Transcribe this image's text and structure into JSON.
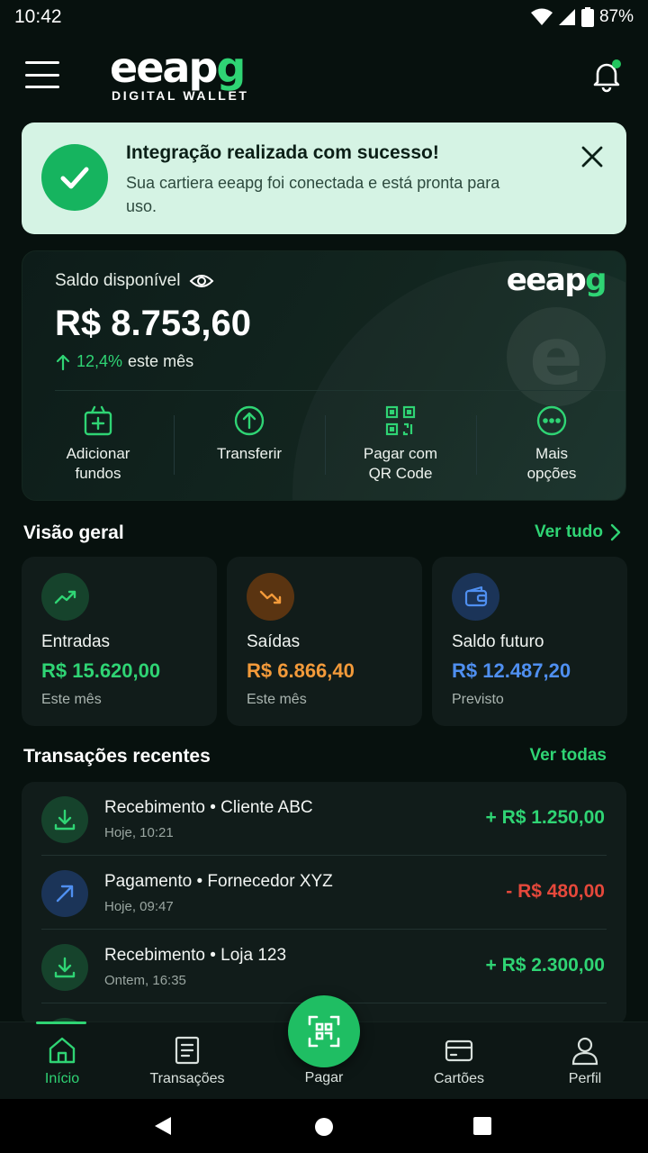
{
  "status_bar": {
    "time": "10:42",
    "battery": "87%"
  },
  "header": {
    "logo_main": "eeap",
    "logo_accent": "g",
    "logo_sub": "DIGITAL WALLET"
  },
  "banner": {
    "title": "Integração realizada com sucesso!",
    "text": "Sua cartiera eeapg foi conectada e está pronta para uso."
  },
  "balance": {
    "label": "Saldo disponível",
    "amount": "R$ 8.753,60",
    "delta_pct": "12,4%",
    "delta_text": "este mês",
    "card_logo_main": "eeap",
    "card_logo_accent": "g",
    "emblem_letter": "e",
    "actions": [
      {
        "label": "Adicionar fundos",
        "icon": "add-funds-icon"
      },
      {
        "label": "Transferir",
        "icon": "transfer-icon"
      },
      {
        "label": "Pagar com QR Code",
        "icon": "qr-code-icon"
      },
      {
        "label": "Mais opções",
        "icon": "more-icon"
      }
    ]
  },
  "overview": {
    "title": "Visão geral",
    "link": "Ver tudo",
    "cards": [
      {
        "label": "Entradas",
        "value": "R$ 15.620,00",
        "sub": "Este mês",
        "color": "#2fd474"
      },
      {
        "label": "Saídas",
        "value": "R$ 6.866,40",
        "sub": "Este mês",
        "color": "#f39a3a"
      },
      {
        "label": "Saldo futuro",
        "value": "R$ 12.487,20",
        "sub": "Previsto",
        "color": "#4f8ff0"
      }
    ]
  },
  "transactions": {
    "title": "Transações recentes",
    "link": "Ver todas",
    "items": [
      {
        "title": "Recebimento • Cliente ABC",
        "time": "Hoje, 10:21",
        "amount": "+ R$ 1.250,00",
        "type": "in"
      },
      {
        "title": "Pagamento • Fornecedor XYZ",
        "time": "Hoje, 09:47",
        "amount": "- R$ 480,00",
        "type": "out"
      },
      {
        "title": "Recebimento • Loja 123",
        "time": "Ontem, 16:35",
        "amount": "+ R$ 2.300,00",
        "type": "in"
      }
    ]
  },
  "bottom_nav": {
    "items": [
      {
        "label": "Início",
        "active": true
      },
      {
        "label": "Transações"
      },
      {
        "label": "Pagar"
      },
      {
        "label": "Cartões"
      },
      {
        "label": "Perfil"
      }
    ]
  },
  "colors": {
    "accent": "#2fd474",
    "negative": "#e5483b",
    "warning": "#f39a3a",
    "info": "#4f8ff0"
  }
}
